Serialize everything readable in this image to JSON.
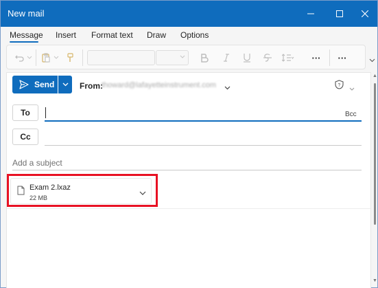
{
  "window": {
    "title": "New mail"
  },
  "ribbon": {
    "tabs": [
      {
        "label": "Message",
        "active": true
      },
      {
        "label": "Insert"
      },
      {
        "label": "Format text"
      },
      {
        "label": "Draw"
      },
      {
        "label": "Options"
      }
    ],
    "more_label": "···",
    "more2_label": "···"
  },
  "compose": {
    "send_label": "Send",
    "from_label": "From:",
    "from_value": "thoward@lafayetteinstrument.com",
    "to_label": "To",
    "bcc_label": "Bcc",
    "cc_label": "Cc",
    "subject_placeholder": "Add a subject"
  },
  "attachment": {
    "file_name": "Exam 2.lxaz",
    "file_size": "22 MB"
  },
  "colors": {
    "accent": "#0f6cbd",
    "highlight": "#e81123"
  },
  "icons": [
    "minimize-icon",
    "maximize-icon",
    "close-icon",
    "undo-icon",
    "paste-icon",
    "format-painter-icon",
    "bold-icon",
    "italic-icon",
    "underline-icon",
    "strikethrough-icon",
    "line-spacing-icon",
    "send-icon",
    "chevron-down-icon",
    "sensitivity-icon",
    "file-icon"
  ]
}
